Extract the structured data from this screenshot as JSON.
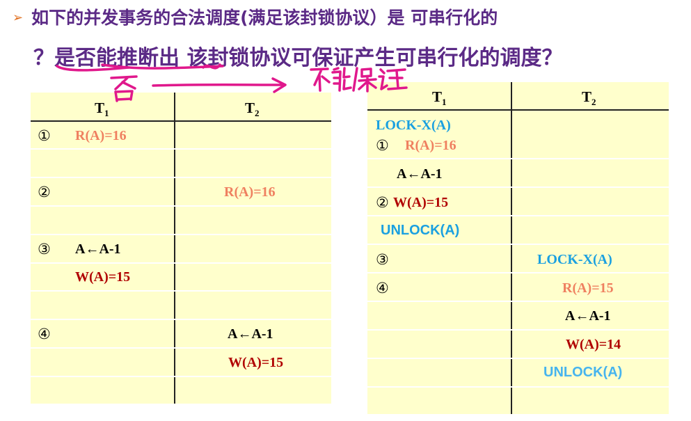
{
  "header": {
    "bullet": "➢",
    "line1": "如下的并发事务的合法调度(满足该封锁协议）是 可串行化的",
    "line2": "？是否能推断出 该封锁协议可保证产生可串行化的调度？"
  },
  "left_table": {
    "col1": "T",
    "col1_sub": "1",
    "col2": "T",
    "col2_sub": "2",
    "rows": {
      "r1_num": "①",
      "r1_t1": "R(A)=16",
      "r2_num": "②",
      "r2_t2": "R(A)=16",
      "r3_num": "③",
      "r3_t1": "A←A-1",
      "r4_t1": "W(A)=15",
      "r5_num": "④",
      "r5_t2": "A←A-1",
      "r6_t2": "W(A)=15"
    }
  },
  "right_table": {
    "col1": "T",
    "col1_sub": "1",
    "col2": "T",
    "col2_sub": "2",
    "rows": {
      "lock_t1": "LOCK-X(A)",
      "r1_num": "①",
      "r1_t1": "R(A)=16",
      "r2_t1": "A←A-1",
      "r3_num": "②",
      "r3_t1": "W(A)=15",
      "r4_t1": "UNLOCK(A)",
      "r5_num": "③",
      "r5_t2": "LOCK-X(A)",
      "r6_num": "④",
      "r6_t2": "R(A)=15",
      "r7_t2": "A←A-1",
      "r8_t2": "W(A)=14",
      "r9_t2": "UNLOCK(A)"
    }
  },
  "colors": {
    "title": "#5b2a86",
    "ink": "#e0188c",
    "table_bg": "#ffffcc",
    "read": "#ef8060",
    "write": "#b00000",
    "lock": "#1aa0e0"
  }
}
